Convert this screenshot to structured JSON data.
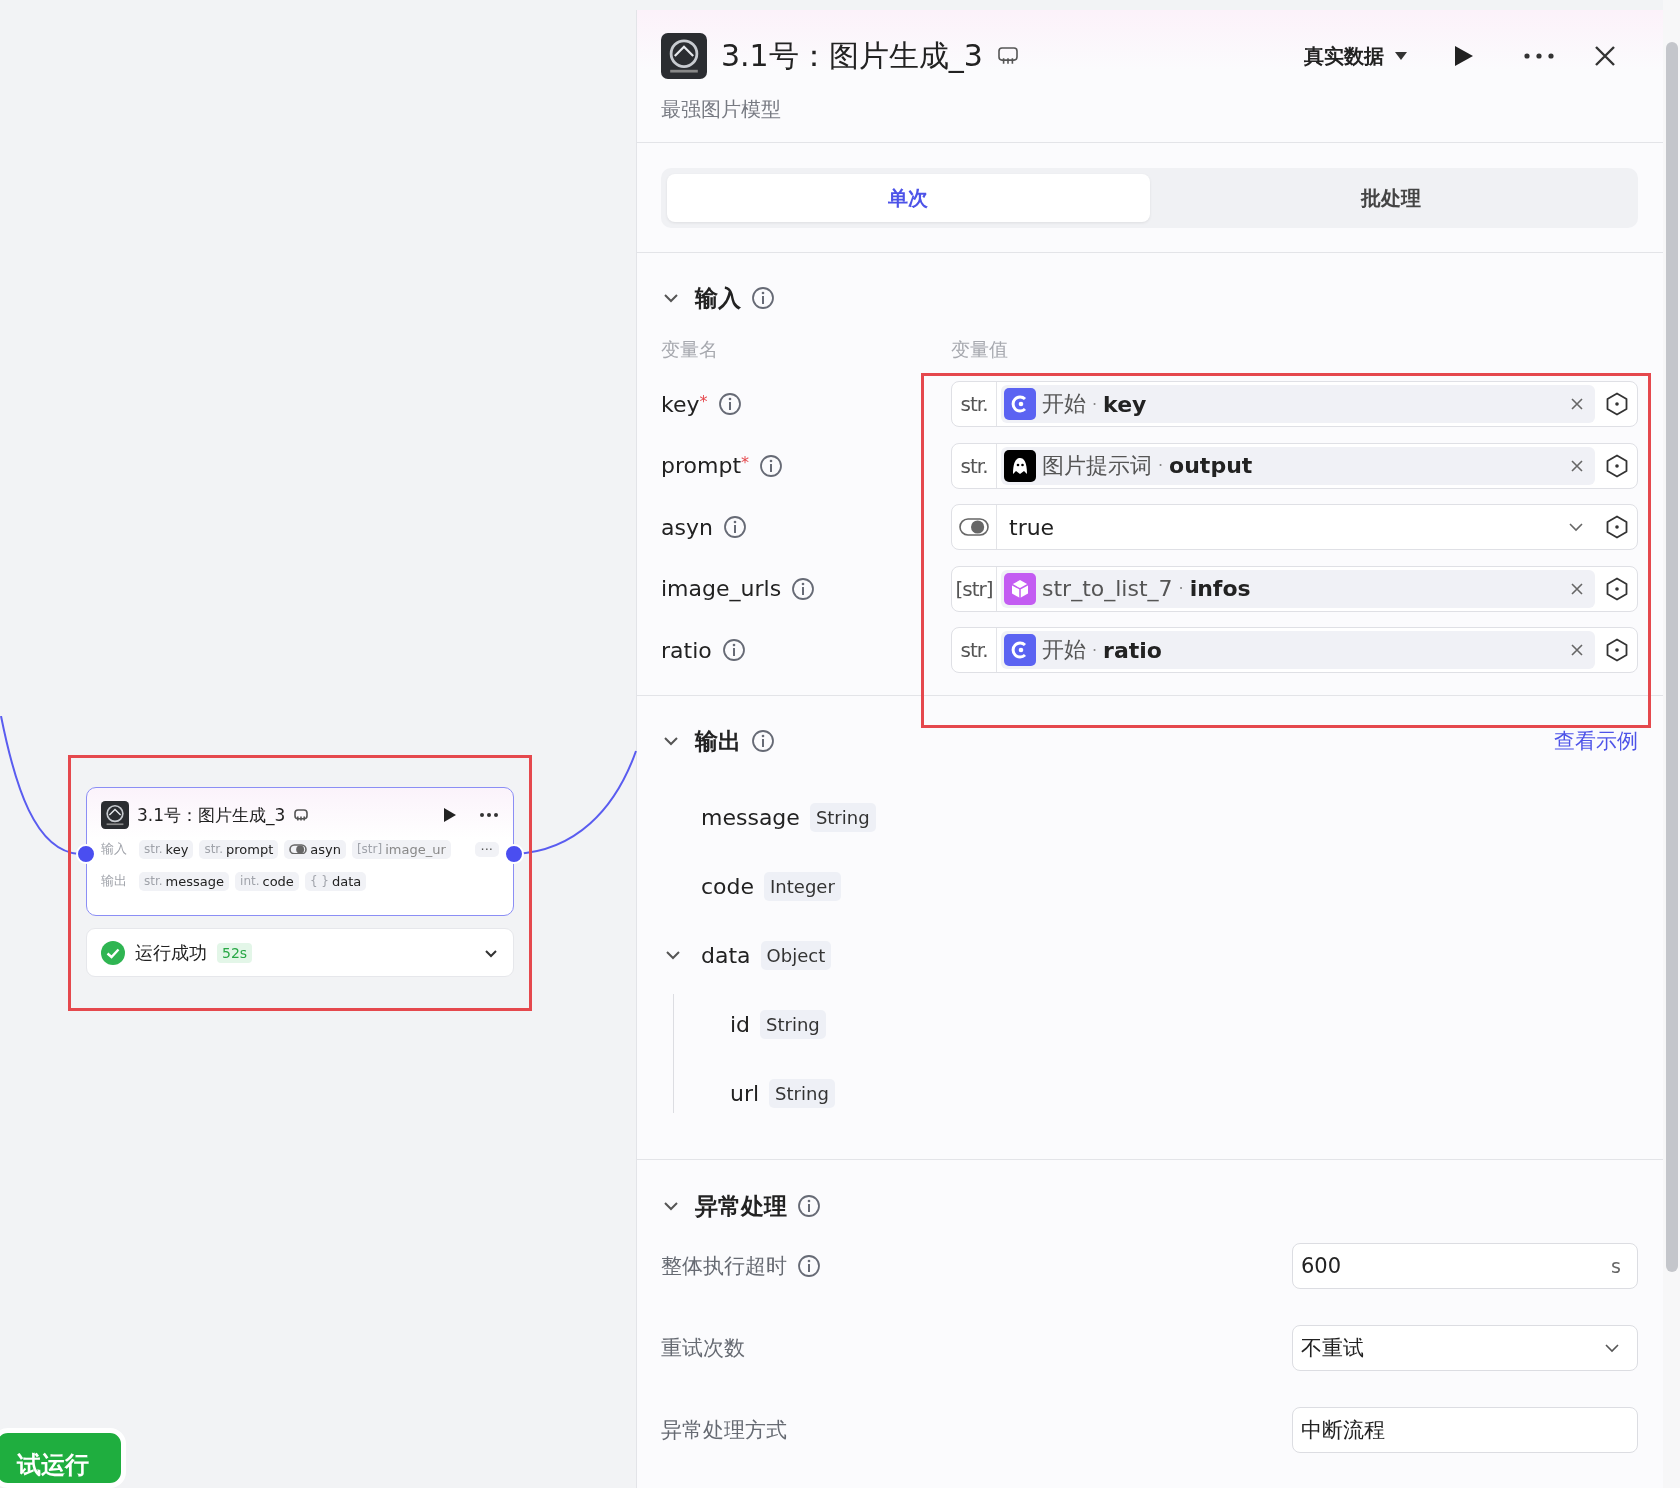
{
  "canvas": {
    "node": {
      "title": "3.1号：图片生成_3",
      "inputs_label": "输入",
      "inputs": [
        {
          "kind": "text",
          "type": "str.",
          "name": "key"
        },
        {
          "kind": "text",
          "type": "str.",
          "name": "prompt"
        },
        {
          "kind": "toggle",
          "name": "asyn"
        },
        {
          "kind": "text",
          "type": "[str]",
          "name": "image_ur"
        }
      ],
      "more": "···",
      "outputs_label": "输出",
      "outputs": [
        {
          "type": "str.",
          "name": "message"
        },
        {
          "type": "int.",
          "name": "code"
        },
        {
          "type": "{ }",
          "name": "data"
        }
      ],
      "status": {
        "kind": "success",
        "text": "运行成功",
        "time": "52s",
        "expanded": false
      }
    },
    "run_button": {
      "label": "试运行"
    }
  },
  "panel": {
    "title": "3.1号：图片生成_3",
    "description": "最强图片模型",
    "data_source": "真实数据",
    "tabs": [
      {
        "label": "单次",
        "selected": true
      },
      {
        "label": "批处理",
        "selected": false
      }
    ],
    "inputs": {
      "title": "输入",
      "expanded": true,
      "name_header": "变量名",
      "value_header": "变量值",
      "rows": [
        {
          "name": "key",
          "required_mark": "*",
          "kind": "reference",
          "type": "str.",
          "source": {
            "kind": "start",
            "text": "开始"
          },
          "separator": "·",
          "field": "key"
        },
        {
          "name": "prompt",
          "required_mark": "*",
          "kind": "reference",
          "type": "str.",
          "source": {
            "kind": "llm",
            "text": "图片提示词"
          },
          "separator": "·",
          "field": "output"
        },
        {
          "name": "asyn",
          "kind": "toggle",
          "value": "true"
        },
        {
          "name": "image_urls",
          "kind": "reference",
          "type": "[str]",
          "source": {
            "kind": "code",
            "text": "str_to_list_7"
          },
          "separator": "·",
          "field": "infos"
        },
        {
          "name": "ratio",
          "kind": "reference",
          "type": "str.",
          "source": {
            "kind": "start",
            "text": "开始"
          },
          "separator": "·",
          "field": "ratio"
        }
      ]
    },
    "outputs": {
      "title": "输出",
      "expanded": true,
      "example_link": "查看示例",
      "items": [
        {
          "name": "message",
          "type": "String"
        },
        {
          "name": "code",
          "type": "Integer"
        },
        {
          "name": "data",
          "type": "Object",
          "expanded": true,
          "children": [
            {
              "name": "id",
              "type": "String"
            },
            {
              "name": "url",
              "type": "String"
            }
          ]
        }
      ]
    },
    "error": {
      "title": "异常处理",
      "expanded": true,
      "fields": [
        {
          "kind": "number",
          "label": "整体执行超时",
          "info": true,
          "value": "600",
          "unit": "s"
        },
        {
          "kind": "select",
          "label": "重试次数",
          "value": "不重试"
        },
        {
          "kind": "select_plain",
          "label": "异常处理方式",
          "value": "中断流程"
        }
      ]
    }
  }
}
